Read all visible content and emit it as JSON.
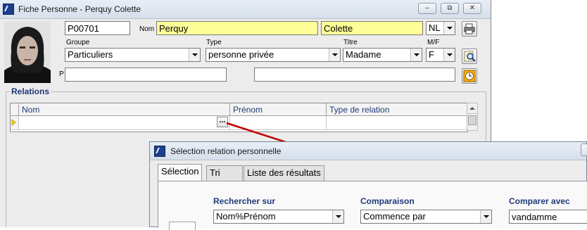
{
  "window": {
    "title": "Fiche Personne - Perquy Colette",
    "minimize": "–",
    "restore": "⧉",
    "close": "✕"
  },
  "form": {
    "id": "P00701",
    "nom_label": "Nom",
    "nom": "Perquy",
    "prenom": "Colette",
    "langue": "NL",
    "groupe_label": "Groupe",
    "groupe": "Particuliers",
    "type_label": "Type",
    "type": "personne privée",
    "titre_label": "Titre",
    "titre": "Madame",
    "mf_label": "M/F",
    "mf": "F",
    "p_label": "P",
    "field_p": "",
    "field_extra": ""
  },
  "relations": {
    "label": "Relations",
    "columns": [
      "Nom",
      "Prénom",
      "Type de relation"
    ],
    "ellipsis": "...",
    "row": {
      "nom": "",
      "prenom": "",
      "type": ""
    }
  },
  "dialog": {
    "title": "Sélection relation personnelle",
    "tabs": [
      "Sélection",
      "Tri",
      "Liste des résultats"
    ],
    "rechercher_label": "Rechercher sur",
    "rechercher_value": "Nom%Prénom",
    "comparaison_label": "Comparaison",
    "comparaison_value": "Commence par",
    "comparer_label": "Comparer avec",
    "comparer_value": "vandamme"
  },
  "colors": {
    "accent": "#1f3a7a",
    "highlight": "#ffff99",
    "arrow": "#c00000"
  }
}
